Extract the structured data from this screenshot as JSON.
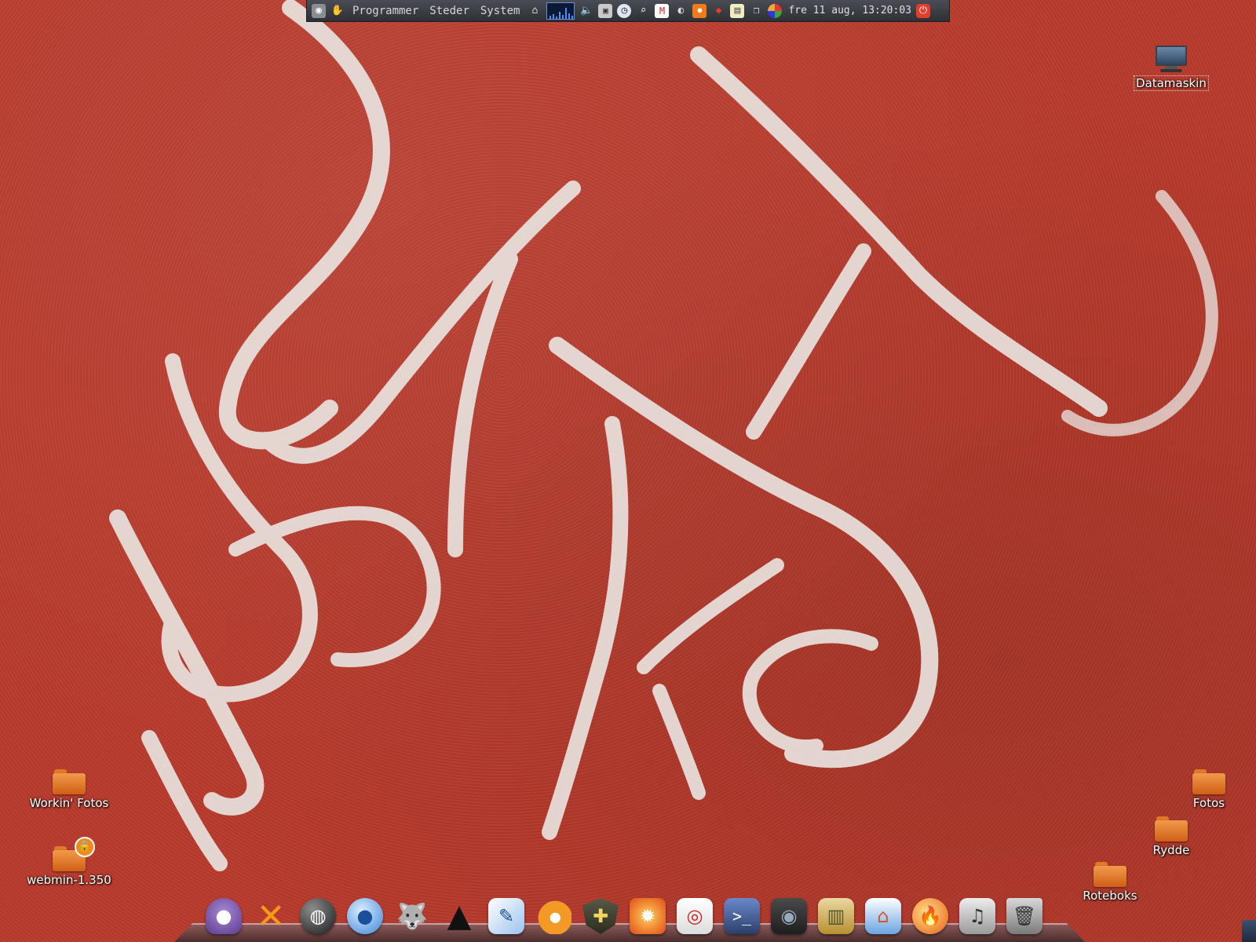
{
  "top_panel": {
    "menus": [
      "Programmer",
      "Steder",
      "System"
    ],
    "clock": "fre 11 aug, 13:20:03",
    "icons": [
      "gnome-foot-icon",
      "home-icon",
      "system-monitor",
      "volume-icon",
      "network-icon",
      "clock-icon",
      "search-icon",
      "mail-icon",
      "weather-icon",
      "updates-icon",
      "ruby-icon",
      "notes-icon",
      "window-list-icon",
      "colors-icon",
      "power-icon"
    ],
    "accent_color": "#e33d2b"
  },
  "desktop_icons": [
    {
      "name": "Datamaskin",
      "icon": "computer-icon"
    },
    {
      "name": "Workin' Fotos",
      "icon": "folder-icon"
    },
    {
      "name": "webmin-1.350",
      "icon": "locked-folder-icon"
    },
    {
      "name": "Fotos",
      "icon": "folder-icon"
    },
    {
      "name": "Rydde",
      "icon": "folder-icon"
    },
    {
      "name": "Roteboks",
      "icon": "folder-icon"
    }
  ],
  "dock": {
    "items": [
      "pidgin-icon",
      "xchat-icon",
      "globe-icon",
      "network-manager-icon",
      "gimp-icon",
      "inkscape-icon",
      "text-editor-icon",
      "blender-icon",
      "security-shield-icon",
      "fire-app-icon",
      "media-burner-icon",
      "terminal-icon",
      "camera-icon",
      "archive-manager-icon",
      "home-folder-icon",
      "firefox-icon",
      "music-player-icon",
      "trash-icon"
    ]
  }
}
